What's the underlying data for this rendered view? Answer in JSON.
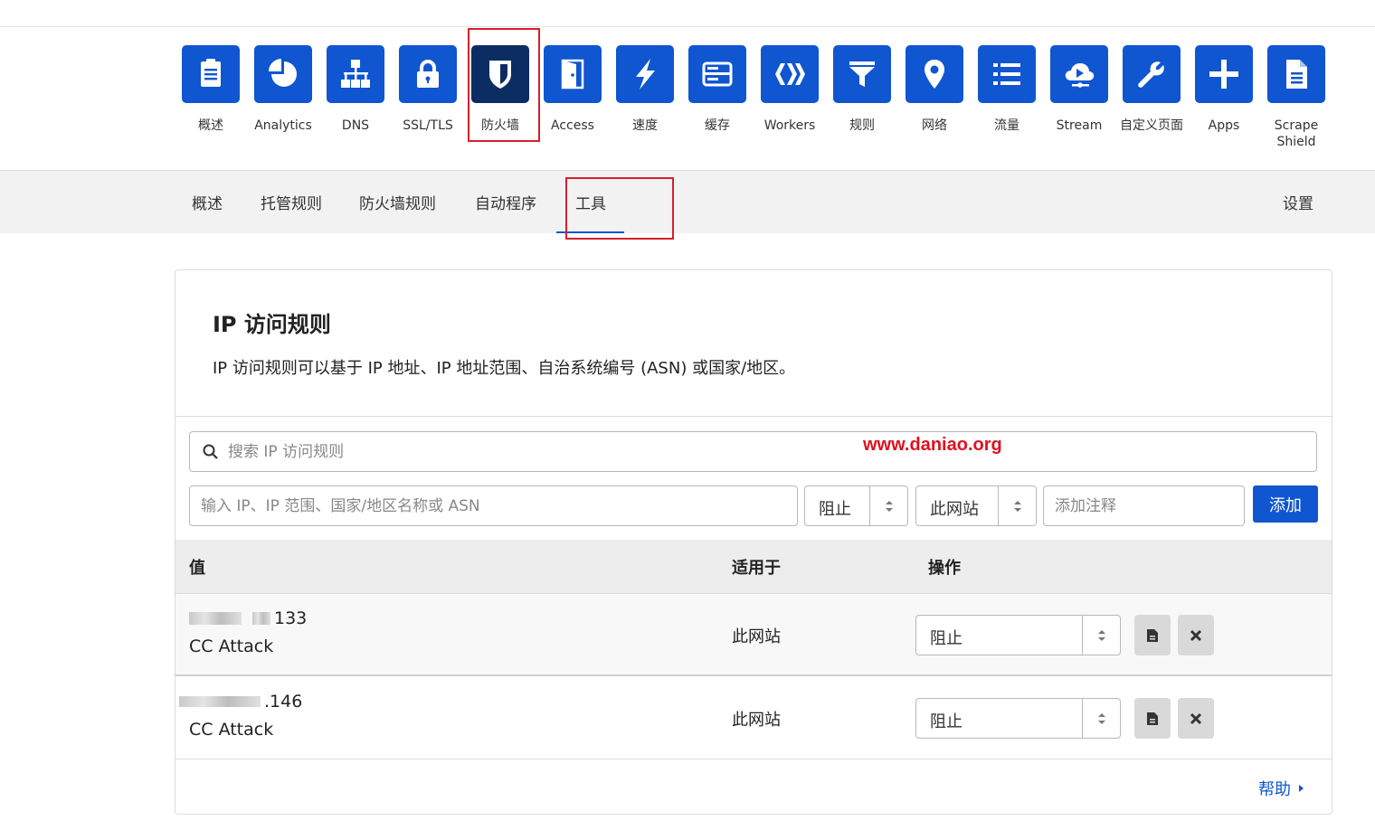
{
  "apps": [
    {
      "label": "概述",
      "icon": "clipboard-icon"
    },
    {
      "label": "Analytics",
      "icon": "pie-chart-icon"
    },
    {
      "label": "DNS",
      "icon": "network-icon"
    },
    {
      "label": "SSL/TLS",
      "icon": "lock-icon"
    },
    {
      "label": "防火墙",
      "icon": "shield-icon",
      "active": true
    },
    {
      "label": "Access",
      "icon": "door-icon"
    },
    {
      "label": "速度",
      "icon": "lightning-icon"
    },
    {
      "label": "缓存",
      "icon": "drive-icon"
    },
    {
      "label": "Workers",
      "icon": "workers-icon"
    },
    {
      "label": "规则",
      "icon": "filter-icon"
    },
    {
      "label": "网络",
      "icon": "location-pin-icon"
    },
    {
      "label": "流量",
      "icon": "list-icon"
    },
    {
      "label": "Stream",
      "icon": "cloud-stream-icon"
    },
    {
      "label": "自定义页面",
      "icon": "wrench-icon"
    },
    {
      "label": "Apps",
      "icon": "plus-icon"
    },
    {
      "label": "Scrape Shield",
      "icon": "document-icon"
    }
  ],
  "subnav": {
    "items": [
      "概述",
      "托管规则",
      "防火墙规则",
      "自动程序",
      "工具"
    ],
    "active": "工具",
    "settings": "设置"
  },
  "card": {
    "title": "IP 访问规则",
    "description": "IP 访问规则可以基于 IP 地址、IP 地址范围、自治系统编号 (ASN) 或国家/地区。"
  },
  "search": {
    "placeholder": "搜索 IP 访问规则"
  },
  "watermark": "www.daniao.org",
  "form": {
    "ip_placeholder": "输入 IP、IP 范围、国家/地区名称或 ASN",
    "action_value": "阻止",
    "scope_value": "此网站",
    "note_placeholder": "添加注释",
    "add_label": "添加"
  },
  "table": {
    "headers": {
      "value": "值",
      "applies": "适用于",
      "actions": "操作"
    },
    "rows": [
      {
        "ip_suffix": "133",
        "note": "CC Attack",
        "applies": "此网站",
        "action": "阻止"
      },
      {
        "ip_suffix": ".146",
        "note": "CC Attack",
        "applies": "此网站",
        "action": "阻止"
      }
    ]
  },
  "help": "帮助",
  "colors": {
    "brand_blue": "#0f56d0",
    "active_tile": "#0c2d63",
    "highlight_red": "#d6202c",
    "watermark_red": "#e0101e"
  }
}
